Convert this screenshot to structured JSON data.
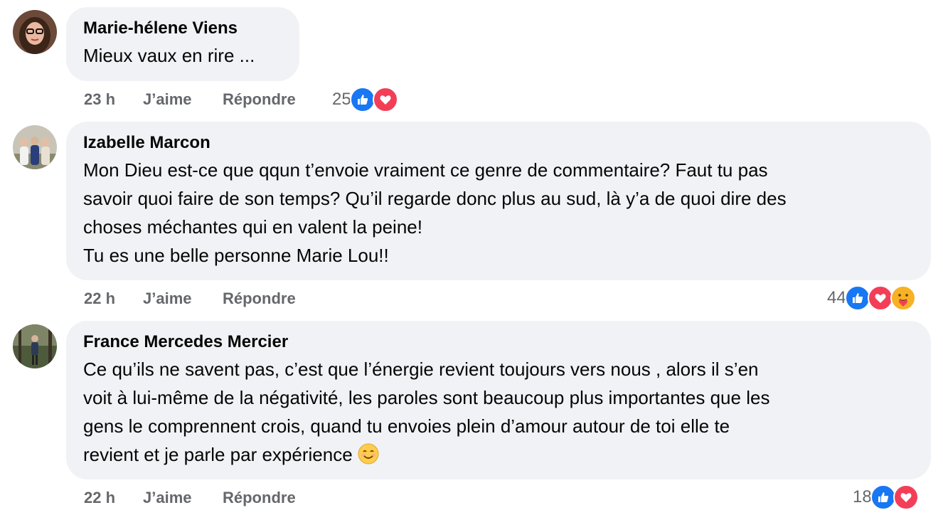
{
  "comments": [
    {
      "author": "Marie-hélene Viens",
      "text": "Mieux vaux en rire ...",
      "time": "23 h",
      "like_label": "J’aime",
      "reply_label": "Répondre",
      "reaction_count": "25",
      "reactions": [
        "like-icon",
        "love-icon"
      ]
    },
    {
      "author": "Izabelle Marcon",
      "text": "Mon Dieu est-ce que qqun t’envoie vraiment ce genre de commentaire? Faut tu pas\nsavoir quoi faire de son temps? Qu’il regarde donc plus au sud, là y’a de quoi dire des\nchoses méchantes qui en valent la peine!\nTu es une belle personne Marie Lou!!",
      "time": "22 h",
      "like_label": "J’aime",
      "reply_label": "Répondre",
      "reaction_count": "44",
      "reactions": [
        "like-icon",
        "love-icon",
        "care-icon"
      ]
    },
    {
      "author": "France Mercedes Mercier",
      "text": "Ce qu’ils ne savent pas, c’est que l’énergie revient toujours vers nous , alors il s’en\nvoit à lui-même de la négativité, les paroles sont beaucoup plus importantes que les\ngens le comprennent crois, quand tu envoies plein d’amour autour de toi elle te\nrevient et je parle par expérience",
      "time": "22 h",
      "like_label": "J’aime",
      "reply_label": "Répondre",
      "reaction_count": "18",
      "reactions": [
        "like-icon",
        "love-icon"
      ]
    }
  ],
  "colors": {
    "bubble": "#f0f2f5",
    "meta_text": "#65676b",
    "like": "#1877f2",
    "love": "#f33e58",
    "care": "#f7b125"
  }
}
